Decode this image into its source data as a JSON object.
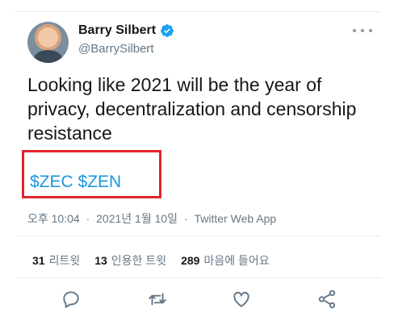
{
  "user": {
    "display_name": "Barry Silbert",
    "handle": "@BarrySilbert",
    "verified": true
  },
  "tweet": {
    "text": "Looking like 2021 will be the year of privacy, decentralization and censorship resistance",
    "hashtags_line": "$ZEC $ZEN"
  },
  "meta": {
    "time": "오후 10:04",
    "date": "2021년 1월 10일",
    "source": "Twitter Web App",
    "separator": "·"
  },
  "stats": {
    "retweets_count": "31",
    "retweets_label": "리트윗",
    "quotes_count": "13",
    "quotes_label": "인용한 트윗",
    "likes_count": "289",
    "likes_label": "마음에 들어요"
  },
  "icons": {
    "avatar": "profile-photo",
    "verified": "verified-badge-icon",
    "more": "more-options-icon",
    "reply": "reply-icon",
    "retweet": "retweet-icon",
    "like": "heart-icon",
    "share": "share-icon"
  },
  "colors": {
    "link": "#1b95e0",
    "highlight_box": "#e3242b",
    "secondary_text": "#657786"
  }
}
